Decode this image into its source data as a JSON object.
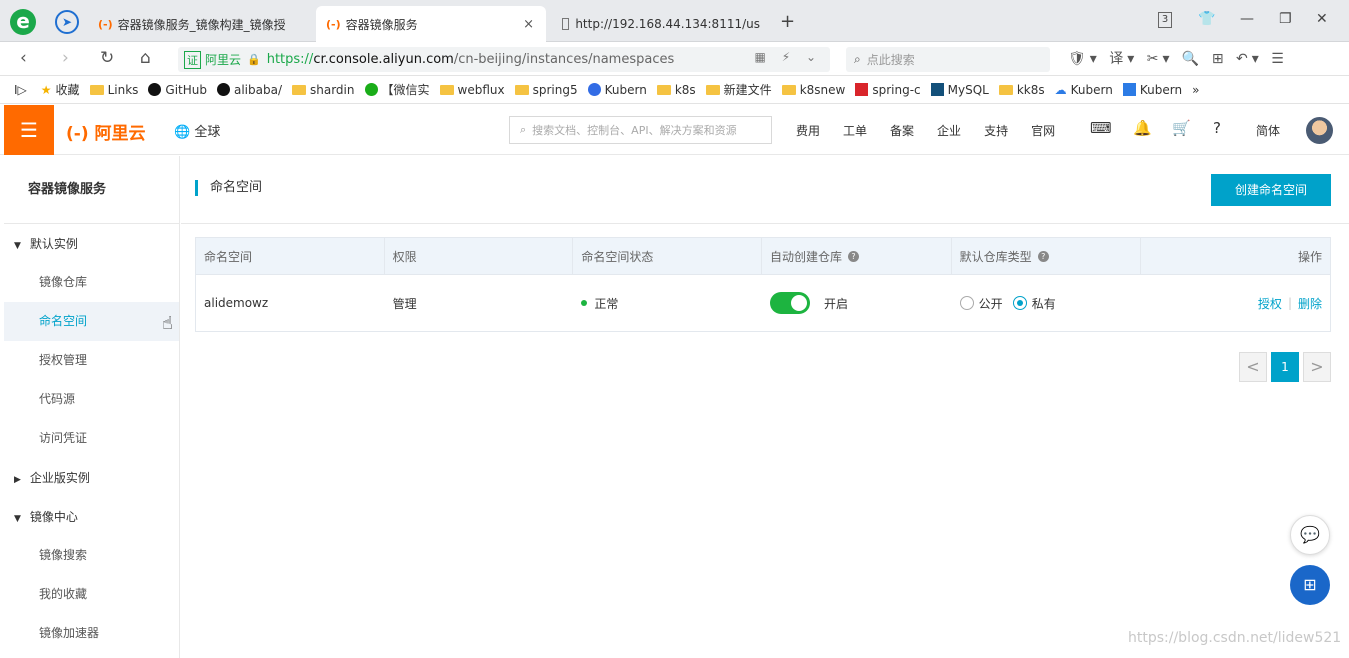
{
  "browser": {
    "tabs": [
      {
        "icon": "(-)",
        "label": "容器镜像服务_镜像构建_镜像授"
      },
      {
        "icon": "(-)",
        "label": "容器镜像服务",
        "close": "×"
      },
      {
        "icon": "",
        "label": "http://192.168.44.134:8111/us"
      }
    ],
    "new_tab": "+",
    "url_badge": "证",
    "site_name": "阿里云",
    "url_scheme": "https://",
    "url_host": "cr.console.aliyun.com",
    "url_path": "/cn-beijing/instances/namespaces",
    "search_placeholder": "点此搜索",
    "bookmarks": [
      {
        "icon": "star",
        "label": "收藏"
      },
      {
        "icon": "folder",
        "label": "Links"
      },
      {
        "icon": "gh",
        "label": "GitHub"
      },
      {
        "icon": "gh",
        "label": "alibaba/"
      },
      {
        "icon": "folder",
        "label": "shardin"
      },
      {
        "icon": "wx",
        "label": "【微信实"
      },
      {
        "icon": "folder",
        "label": "webflux"
      },
      {
        "icon": "folder",
        "label": "spring5"
      },
      {
        "icon": "k8",
        "label": "Kubern"
      },
      {
        "icon": "folder",
        "label": "k8s"
      },
      {
        "icon": "folder",
        "label": "新建文件"
      },
      {
        "icon": "folder",
        "label": "k8snew"
      },
      {
        "icon": "sq-red",
        "label": "spring-c"
      },
      {
        "icon": "sq-navy",
        "label": "MySQL"
      },
      {
        "icon": "folder",
        "label": "kk8s"
      },
      {
        "icon": "cloud",
        "label": "Kubern"
      },
      {
        "icon": "sq-blue",
        "label": "Kubern"
      }
    ],
    "bookmarks_more": "»"
  },
  "header": {
    "logo": "(-) 阿里云",
    "region": "全球",
    "search_placeholder": "搜索文档、控制台、API、解决方案和资源",
    "links": [
      "费用",
      "工单",
      "备案",
      "企业",
      "支持",
      "官网"
    ],
    "language": "简体"
  },
  "sidebar": {
    "title": "容器镜像服务",
    "groups": [
      {
        "label": "默认实例",
        "expanded": true,
        "items": [
          "镜像仓库",
          "命名空间",
          "授权管理",
          "代码源",
          "访问凭证"
        ]
      },
      {
        "label": "企业版实例",
        "expanded": false,
        "items": []
      },
      {
        "label": "镜像中心",
        "expanded": true,
        "items": [
          "镜像搜索",
          "我的收藏",
          "镜像加速器"
        ]
      }
    ],
    "active_item": "命名空间"
  },
  "main": {
    "title": "命名空间",
    "create_button": "创建命名空间",
    "columns": [
      "命名空间",
      "权限",
      "命名空间状态",
      "自动创建仓库",
      "默认仓库类型",
      "操作"
    ],
    "rows": [
      {
        "name": "alidemowz",
        "permission": "管理",
        "status": "正常",
        "auto_create_label": "开启",
        "auto_create_on": true,
        "repo_type_options": [
          "公开",
          "私有"
        ],
        "repo_type_selected": "私有",
        "actions": [
          "授权",
          "删除"
        ]
      }
    ],
    "pagination": {
      "prev": "<",
      "current": "1",
      "next": ">"
    }
  },
  "watermark": "https://blog.csdn.net/lidew521",
  "colors": {
    "brand_orange": "#ff6a00",
    "accent": "#00a2ca",
    "success": "#1db440",
    "fab_blue": "#1a67c9"
  }
}
